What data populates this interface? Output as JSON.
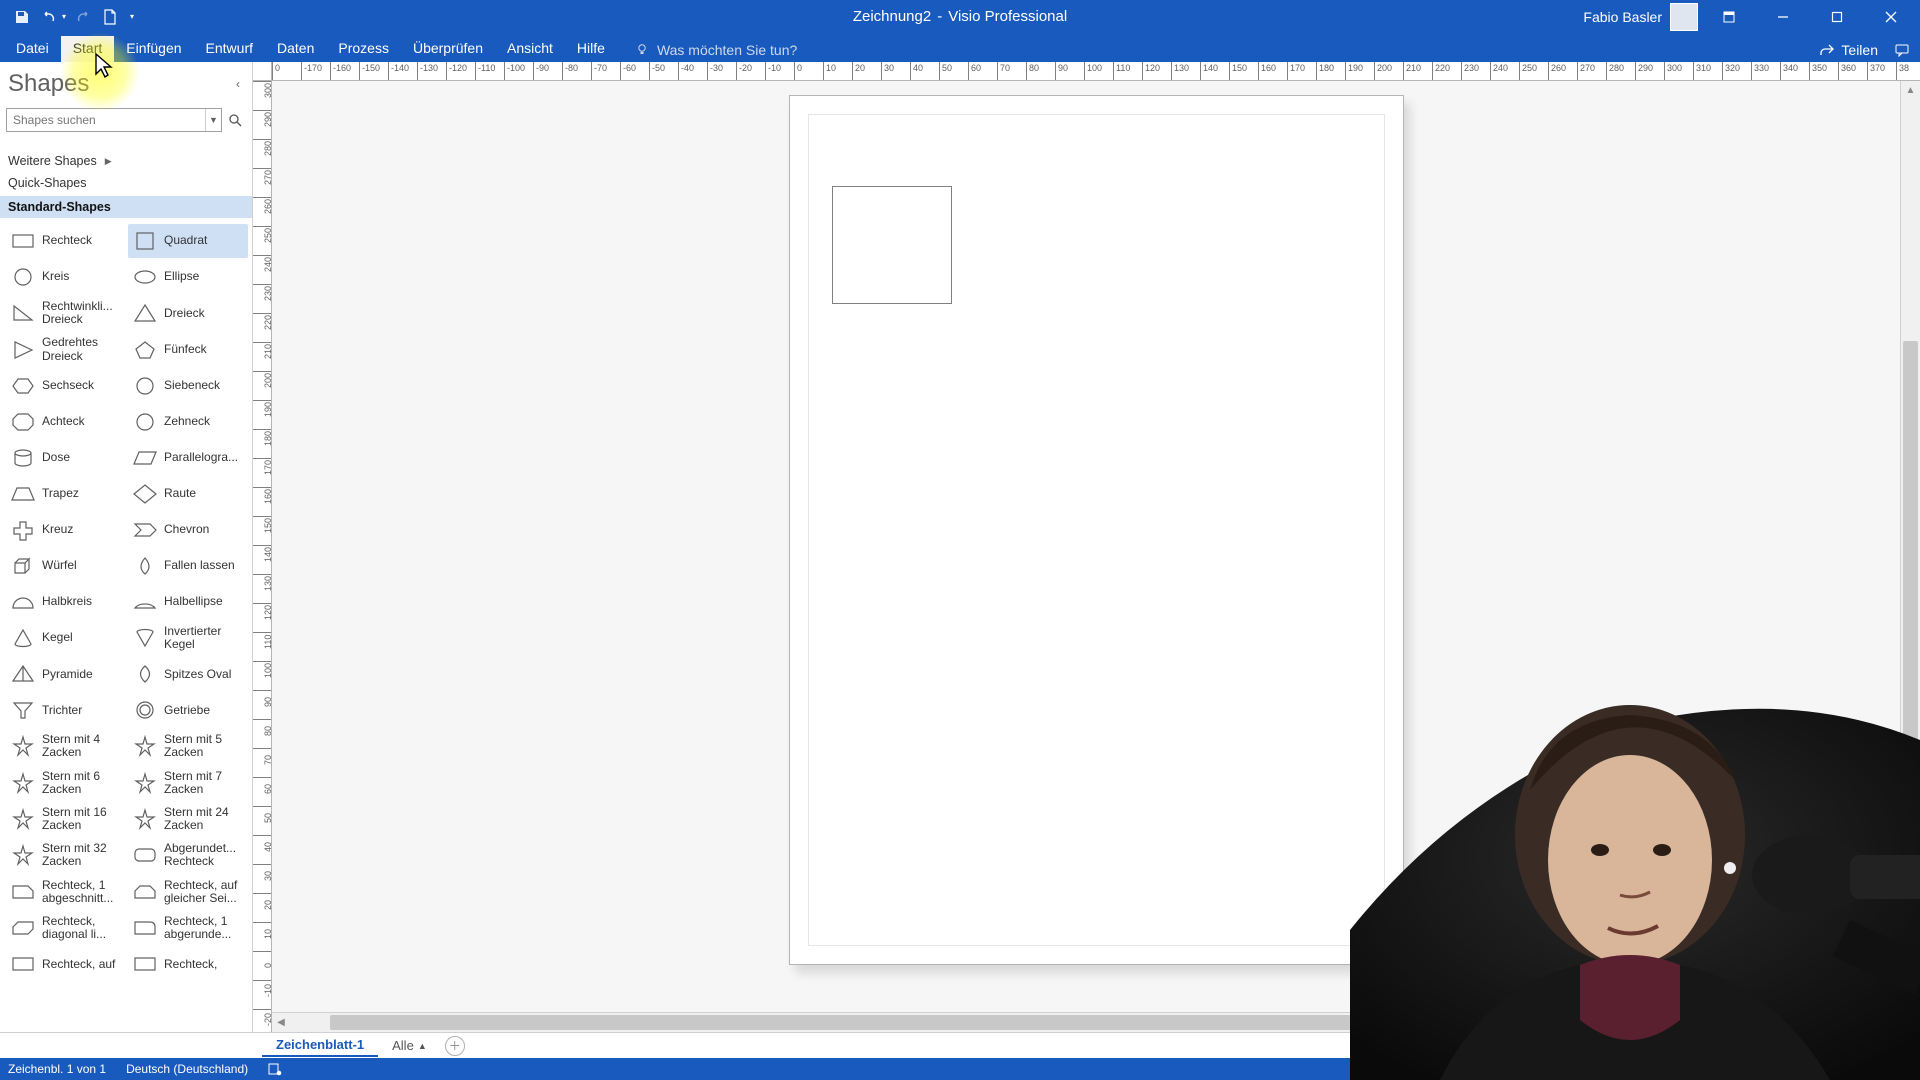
{
  "app": {
    "doc_title": "Zeichnung2",
    "app_name": "Visio Professional",
    "separator": " - "
  },
  "user": {
    "name": "Fabio Basler"
  },
  "ribbon": {
    "tabs": [
      "Datei",
      "Start",
      "Einfügen",
      "Entwurf",
      "Daten",
      "Prozess",
      "Überprüfen",
      "Ansicht",
      "Hilfe"
    ],
    "active_index": 1,
    "search_placeholder": "Was möchten Sie tun?",
    "share_label": "Teilen"
  },
  "shapes_panel": {
    "title": "Shapes",
    "search_placeholder": "Shapes suchen",
    "more_shapes_label": "Weitere Shapes",
    "quick_shapes_label": "Quick-Shapes",
    "active_stencil_label": "Standard-Shapes",
    "highlighted_shape_index": 1,
    "shapes": [
      {
        "label": "Rechteck",
        "icon": "rect"
      },
      {
        "label": "Quadrat",
        "icon": "square"
      },
      {
        "label": "Kreis",
        "icon": "circle"
      },
      {
        "label": "Ellipse",
        "icon": "ellipse"
      },
      {
        "label": "Rechtwinkli... Dreieck",
        "icon": "right-tri"
      },
      {
        "label": "Dreieck",
        "icon": "tri"
      },
      {
        "label": "Gedrehtes Dreieck",
        "icon": "tri-left"
      },
      {
        "label": "Fünfeck",
        "icon": "pentagon"
      },
      {
        "label": "Sechseck",
        "icon": "hexagon"
      },
      {
        "label": "Siebeneck",
        "icon": "heptagon"
      },
      {
        "label": "Achteck",
        "icon": "octagon"
      },
      {
        "label": "Zehneck",
        "icon": "decagon"
      },
      {
        "label": "Dose",
        "icon": "can"
      },
      {
        "label": "Parallelogra...",
        "icon": "para"
      },
      {
        "label": "Trapez",
        "icon": "trap"
      },
      {
        "label": "Raute",
        "icon": "diamond"
      },
      {
        "label": "Kreuz",
        "icon": "plus"
      },
      {
        "label": "Chevron",
        "icon": "chevron"
      },
      {
        "label": "Würfel",
        "icon": "cube"
      },
      {
        "label": "Fallen lassen",
        "icon": "drop"
      },
      {
        "label": "Halbkreis",
        "icon": "semicircle"
      },
      {
        "label": "Halbellipse",
        "icon": "semiellipse"
      },
      {
        "label": "Kegel",
        "icon": "cone"
      },
      {
        "label": "Invertierter Kegel",
        "icon": "cone-inv"
      },
      {
        "label": "Pyramide",
        "icon": "pyramid"
      },
      {
        "label": "Spitzes Oval",
        "icon": "pointed-oval"
      },
      {
        "label": "Trichter",
        "icon": "funnel"
      },
      {
        "label": "Getriebe",
        "icon": "gear"
      },
      {
        "label": "Stern mit 4 Zacken",
        "icon": "star4"
      },
      {
        "label": "Stern mit 5 Zacken",
        "icon": "star5"
      },
      {
        "label": "Stern mit 6 Zacken",
        "icon": "star6"
      },
      {
        "label": "Stern mit 7 Zacken",
        "icon": "star7"
      },
      {
        "label": "Stern mit 16 Zacken",
        "icon": "star16"
      },
      {
        "label": "Stern mit 24 Zacken",
        "icon": "star24"
      },
      {
        "label": "Stern mit 32 Zacken",
        "icon": "star32"
      },
      {
        "label": "Abgerundet... Rechteck",
        "icon": "roundrect"
      },
      {
        "label": "Rechteck, 1 abgeschnitt...",
        "icon": "snip1"
      },
      {
        "label": "Rechteck, auf gleicher Sei...",
        "icon": "snip-same"
      },
      {
        "label": "Rechteck, diagonal li...",
        "icon": "snip-diag"
      },
      {
        "label": "Rechteck, 1 abgerunde...",
        "icon": "round1"
      },
      {
        "label": "Rechteck, auf",
        "icon": "rect"
      },
      {
        "label": "Rechteck,",
        "icon": "rect"
      }
    ]
  },
  "ruler": {
    "h_ticks": [
      "0",
      "-170",
      "-160",
      "-150",
      "-140",
      "-130",
      "-120",
      "-110",
      "-100",
      "-90",
      "-80",
      "-70",
      "-60",
      "-50",
      "-40",
      "-30",
      "-20",
      "-10",
      "0",
      "10",
      "20",
      "30",
      "40",
      "50",
      "60",
      "70",
      "80",
      "90",
      "100",
      "110",
      "120",
      "130",
      "140",
      "150",
      "160",
      "170",
      "180",
      "190",
      "200",
      "210",
      "220",
      "230",
      "240",
      "250",
      "260",
      "270",
      "280",
      "290",
      "300",
      "310",
      "320",
      "330",
      "340",
      "350",
      "360",
      "370",
      "38"
    ],
    "v_ticks": [
      "300",
      "290",
      "280",
      "270",
      "260",
      "250",
      "240",
      "230",
      "220",
      "210",
      "200",
      "190",
      "180",
      "170",
      "160",
      "150",
      "140",
      "130",
      "120",
      "110",
      "100",
      "90",
      "80",
      "70",
      "60",
      "50",
      "40",
      "30",
      "20",
      "10",
      "0",
      "-10",
      "-20"
    ]
  },
  "pages": {
    "active_tab": "Zeichenblatt-1",
    "all_label": "Alle"
  },
  "statusbar": {
    "page_info": "Zeichenbl. 1 von 1",
    "language": "Deutsch (Deutschland)"
  }
}
